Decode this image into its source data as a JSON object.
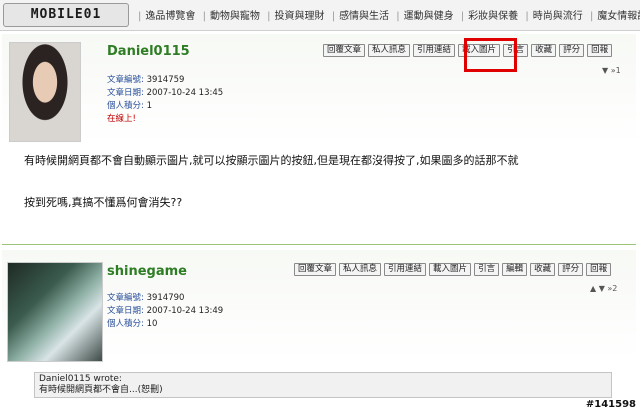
{
  "logo": "MOBILE01",
  "nav": [
    "逸品博覽會",
    "動物與寵物",
    "投資與理財",
    "感情與生活",
    "運動與健身",
    "彩妝與保養",
    "時尚與流行",
    "魔女情報誌"
  ],
  "posts": [
    {
      "username": "Daniel0115",
      "article_id_label": "文章編號:",
      "article_id": "3914759",
      "date_label": "文章日期:",
      "date": "2007-10-24 13:45",
      "points_label": "個人積分:",
      "points": "1",
      "status": "在線上!",
      "buttons": [
        "回覆文章",
        "私人訊息",
        "引用連結",
        "載入圖片",
        "引言",
        "收藏",
        "評分",
        "回報"
      ],
      "floor": "▼ »1",
      "body_lines": [
        "有時候開網頁都不會自動顯示圖片,就可以按顯示圖片的按鈕,但是現在都沒得按了,如果圖多的話那不就",
        "按到死嗎,真搞不懂爲何會消失??"
      ]
    },
    {
      "username": "shinegame",
      "article_id_label": "文章編號:",
      "article_id": "3914790",
      "date_label": "文章日期:",
      "date": "2007-10-24 13:49",
      "points_label": "個人積分:",
      "points": "10",
      "buttons": [
        "回覆文章",
        "私人訊息",
        "引用連結",
        "載入圖片",
        "引言",
        "編輯",
        "收藏",
        "評分",
        "回報"
      ],
      "floor": "▲ ▼ »2",
      "quote_author": "Daniel0115 wrote:",
      "quote_text": "有時候開網頁都不會自...(恕刪)"
    }
  ],
  "watermark": "#141598"
}
